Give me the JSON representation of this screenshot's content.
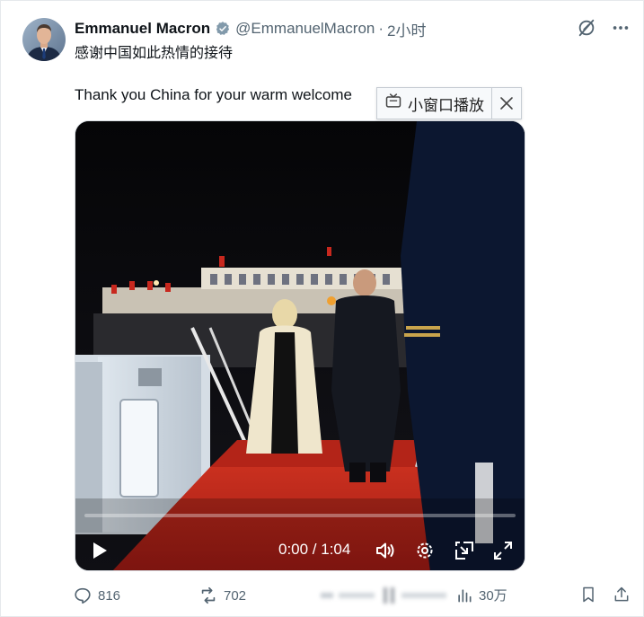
{
  "tweet": {
    "display_name": "Emmanuel Macron",
    "handle": "@EmmanuelMacron",
    "separator": "·",
    "time": "2小时",
    "text_cn": "感谢中国如此热情的接待",
    "text_en": "Thank you China for your warm welcome"
  },
  "pip_popup": {
    "label": "小窗口播放",
    "icon": "tv-icon",
    "close_icon": "close-icon"
  },
  "video": {
    "time_display": "0:00 / 1:04",
    "progress": 0.0,
    "controls": [
      "play-icon",
      "volume-icon",
      "settings-icon",
      "pip-icon",
      "fullscreen-icon"
    ]
  },
  "actions": {
    "replies": "816",
    "reposts": "702",
    "views": "30万"
  },
  "colors": {
    "accent_blue": "#1d9bf0",
    "muted_text": "#536471",
    "text": "#0f1419"
  }
}
